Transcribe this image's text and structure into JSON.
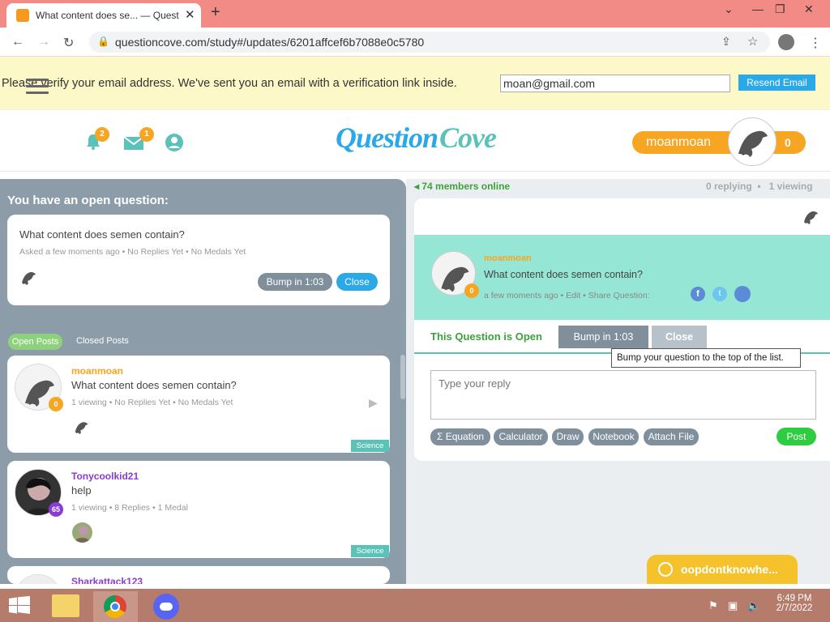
{
  "browser": {
    "tab_title": "What content does se... — Quest",
    "url": "questioncove.com/study#/updates/6201affcef6b7088e0c5780"
  },
  "verify_banner": {
    "message": "Please verify your email address. We've sent you an email with a verification link inside.",
    "email_value": "moan@gmail.com",
    "resend_label": "Resend Email"
  },
  "header": {
    "logo_text": "QuestionCove",
    "notifications_count": "2",
    "messages_count": "1",
    "username": "moanmoan",
    "user_score": "0"
  },
  "open_question": {
    "heading": "You have an open question:",
    "question": "What content does semen contain?",
    "meta": "Asked a few moments ago  •  No Replies Yet  •  No Medals Yet",
    "bump_label": "Bump in 1:03",
    "close_label": "Close"
  },
  "post_tabs": {
    "open": "Open Posts",
    "closed": "Closed Posts"
  },
  "posts": [
    {
      "author": "moanmoan",
      "author_color": "#f6a623",
      "text": "What content does semen contain?",
      "meta": "1 viewing  •  No Replies Yet  •  No Medals Yet",
      "level": "0",
      "level_color": "#f6a623",
      "tag": "Science"
    },
    {
      "author": "Tonycoolkid21",
      "author_color": "#8a3bd1",
      "text": "help",
      "meta": "1 viewing  •  8 Replies  •  1 Medal",
      "level": "65",
      "level_color": "#8a3bd1",
      "tag": "Science"
    },
    {
      "author": "Sharkattack123",
      "author_color": "#8a3bd1"
    }
  ],
  "right_panel": {
    "members_online": "74 members online",
    "replying": "0 replying",
    "viewing": "1 viewing",
    "author": "moanmoan",
    "question": "What content does semen contain?",
    "meta": "a few moments ago  •  Edit  •  Share Question:",
    "level": "0",
    "status": "This Question is Open",
    "bump_label": "Bump in 1:03",
    "close_label": "Close",
    "tooltip": "Bump your question to the top of the list.",
    "reply_placeholder": "Type your reply",
    "tools": [
      "Σ  Equation",
      "Calculator",
      "Draw",
      "Notebook",
      "Attach File"
    ],
    "post_label": "Post"
  },
  "chat": {
    "name": "oopdontknowhe..."
  },
  "taskbar": {
    "time": "6:49 PM",
    "date": "2/7/2022"
  },
  "colors": {
    "brand_blue": "#2ba8e8",
    "brand_orange": "#f6a623",
    "teal": "#96e6d6",
    "panel_gray": "#8c9ca8",
    "green": "#2ecc40"
  }
}
